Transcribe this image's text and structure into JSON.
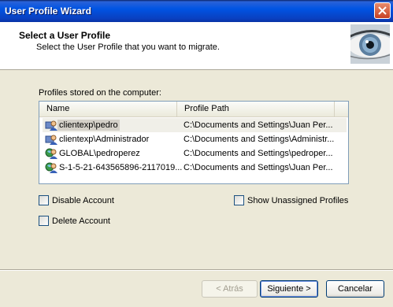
{
  "window": {
    "title": "User Profile Wizard"
  },
  "header": {
    "title": "Select a User Profile",
    "subtitle": "Select the User Profile that you want to migrate.",
    "image": "eye-image"
  },
  "profiles": {
    "label": "Profiles stored on the computer:",
    "columns": [
      "Name",
      "Profile Path"
    ],
    "rows": [
      {
        "name": "clientexp\\pedro",
        "path": "C:\\Documents and Settings\\Juan Per...",
        "icon": "local-user-icon",
        "selected": true
      },
      {
        "name": "clientexp\\Administrador",
        "path": "C:\\Documents and Settings\\Administr...",
        "icon": "local-user-icon",
        "selected": false
      },
      {
        "name": "GLOBAL\\pedroperez",
        "path": "C:\\Documents and Settings\\pedroper...",
        "icon": "domain-user-icon",
        "selected": false
      },
      {
        "name": "S-1-5-21-643565896-2117019...",
        "path": "C:\\Documents and Settings\\Juan Per...",
        "icon": "domain-user-icon",
        "selected": false
      }
    ]
  },
  "options": {
    "disable_account": "Disable Account",
    "delete_account": "Delete Account",
    "show_unassigned": "Show Unassigned Profiles"
  },
  "buttons": {
    "back": "< Atrás",
    "next": "Siguiente >",
    "cancel": "Cancelar"
  },
  "colors": {
    "titlebar": "#0054e3",
    "dialog": "#ece9d8",
    "selection": "#d4d0c8"
  }
}
